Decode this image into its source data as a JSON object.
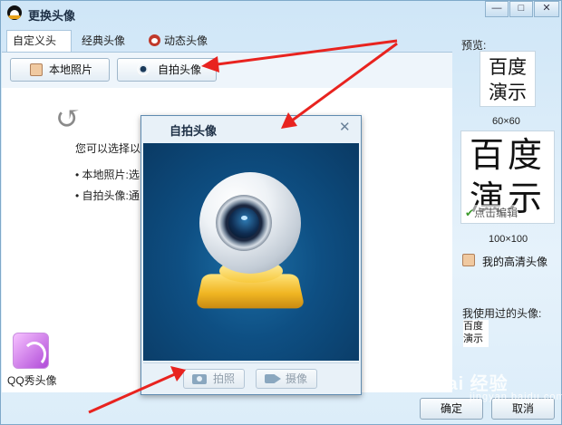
{
  "window": {
    "title": "更换头像",
    "min": "—",
    "max": "□",
    "close": "✕"
  },
  "tabs": [
    {
      "label": "自定义头像"
    },
    {
      "label": "经典头像"
    },
    {
      "label": "动态头像"
    }
  ],
  "toolbar": {
    "local_label": "本地照片",
    "self_label": "自拍头像"
  },
  "content": {
    "hint": "您可以选择以",
    "bullets": [
      "• 本地照片:选",
      "• 自拍头像:通"
    ]
  },
  "qqshow": {
    "label": "QQ秀头像"
  },
  "side": {
    "preview_label": "预览:",
    "preview_text_line1": "百度",
    "preview_text_line2": "演示",
    "size_small": "60×60",
    "size_big": "100×100",
    "edit_tag": "点击编辑",
    "hd_label": "我的高清头像",
    "used_label": "我使用过的头像:",
    "used_text_line1": "百度",
    "used_text_line2": "演示"
  },
  "dialog": {
    "title": "自拍头像",
    "close": "✕",
    "shoot_label": "拍照",
    "record_label": "摄像"
  },
  "footer": {
    "ok_label": "确定",
    "cancel_label": "取消"
  },
  "watermark": {
    "main": "Bai 经验",
    "sub": "jingyan.baidu.com"
  },
  "colors": {
    "arrow": "#e8231f",
    "accent": "#1d2f45"
  }
}
